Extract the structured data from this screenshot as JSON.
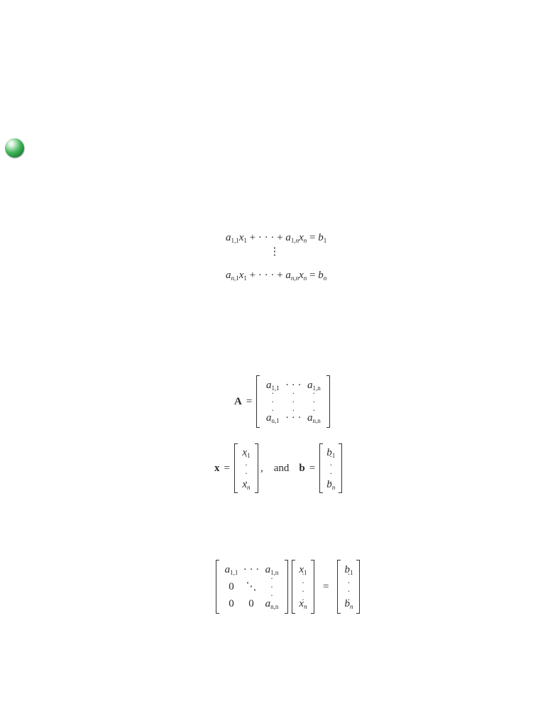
{
  "bullet_icon": "green-sphere-bullet",
  "bullet_color": "#2e9d48",
  "system": {
    "row1": {
      "a": "a",
      "a_sub": "1,1",
      "x": "x",
      "x_sub": "1",
      "dots": "+ · · · +",
      "a2": "a",
      "a2_sub": "1,",
      "a2_sub_n": "n",
      "x2": "x",
      "x2_sub": "n",
      "eq": "=",
      "b": "b",
      "b_sub": "1"
    },
    "vdots": "⋮",
    "row2": {
      "a": "a",
      "a_sub": "n",
      "a_sub2": ",1",
      "x": "x",
      "x_sub": "1",
      "dots": "+ · · · +",
      "a2": "a",
      "a2_sub": "n,n",
      "x2": "x",
      "x2_sub": "n",
      "eq": "=",
      "b": "b",
      "b_sub": "n"
    }
  },
  "matrix_A": {
    "label": "A",
    "eq": "=",
    "r1": {
      "a": "a",
      "a_sub": "1,1",
      "dots": "· · ·",
      "c": "a",
      "c_sub": "1,n"
    },
    "r3": {
      "a": "a",
      "a_sub": "n,1",
      "dots": "· · ·",
      "c": "a",
      "c_sub": "n,n"
    }
  },
  "vectors": {
    "x_label": "x",
    "eq": "=",
    "x_top": "x",
    "x_top_sub": "1",
    "x_bot": "x",
    "x_bot_sub": "n",
    "comma": ",",
    "and": "and",
    "b_label": "b",
    "b_top": "b",
    "b_top_sub": "1",
    "b_bot": "b",
    "b_bot_sub": "n"
  },
  "upper": {
    "r1": {
      "a": "a",
      "a_sub": "1,1",
      "dots": "· · ·",
      "c": "a",
      "c_sub": "1,n"
    },
    "r2": {
      "a": "0",
      "dots": "⋱"
    },
    "r3": {
      "a": "0",
      "b": "0",
      "c": "a",
      "c_sub": "n,n"
    },
    "x_top": "x",
    "x_top_sub": "1",
    "x_bot": "x",
    "x_bot_sub": "n",
    "eq": "=",
    "b_top": "b",
    "b_top_sub": "1",
    "b_bot": "b",
    "b_bot_sub": "n"
  }
}
